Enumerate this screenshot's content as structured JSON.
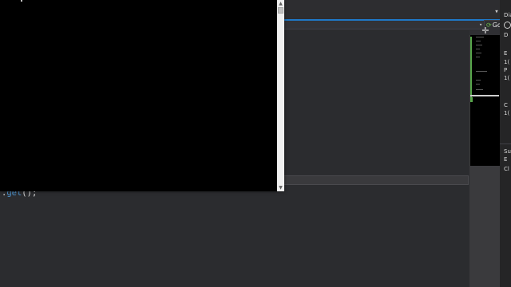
{
  "editor": {
    "code_line": {
      "prefix": ".",
      "method": "get",
      "suffix": "();"
    }
  },
  "tab_strip": {
    "dropdown_glyph": "▾"
  },
  "navigation_bar": {
    "dropdown_glyph": "▾",
    "go_label": "Go"
  },
  "minimap": {
    "add_glyph": "✛"
  },
  "side_panel": {
    "labels": [
      "Dia",
      "D",
      "E",
      "1(",
      "P",
      "1(",
      "C",
      "1(",
      "Su",
      "E",
      "Cl"
    ]
  },
  "console": {
    "scroll_up_glyph": "▲",
    "scroll_down_glyph": "▼"
  },
  "colors": {
    "accent": "#1f79c8",
    "method": "#4e94ce",
    "go_icon": "#6cc04a",
    "console_bg": "#000000",
    "editor_bg": "#2b2c2f"
  }
}
